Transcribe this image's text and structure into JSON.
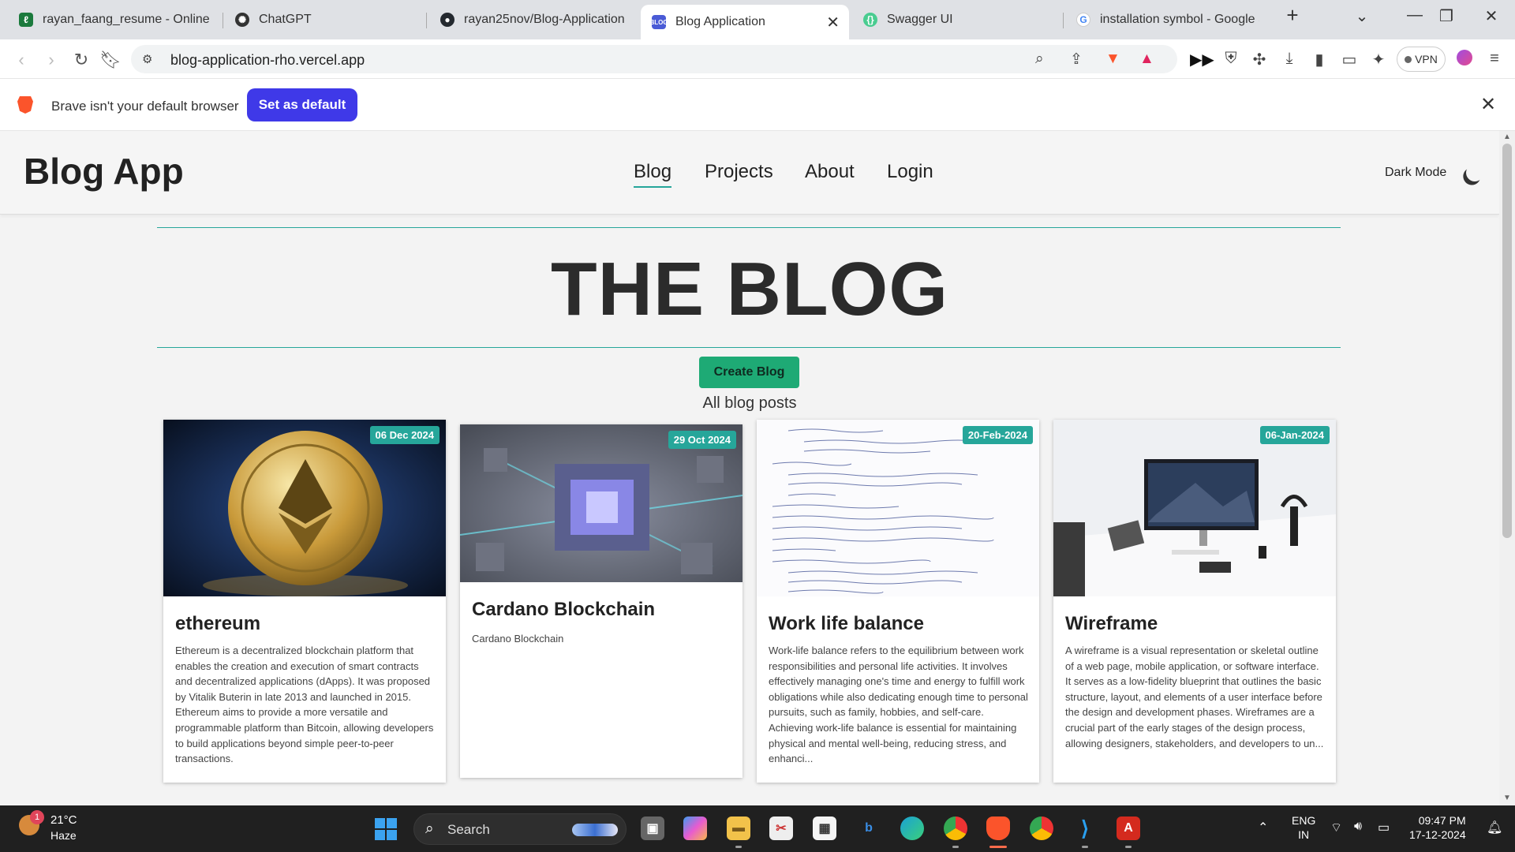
{
  "browser": {
    "tabs": [
      {
        "label": "rayan_faang_resume - Online La",
        "icon": "overleaf-icon",
        "color": "#1b7a3d"
      },
      {
        "label": "ChatGPT",
        "icon": "chatgpt-icon",
        "color": "#333333"
      },
      {
        "label": "rayan25nov/Blog-Application",
        "icon": "github-icon",
        "color": "#24292f"
      },
      {
        "label": "Blog Application",
        "icon": "blog-favicon-icon",
        "color": "#4a5bd6",
        "active": true
      },
      {
        "label": "Swagger UI",
        "icon": "swagger-icon",
        "color": "#49cc90"
      },
      {
        "label": "installation symbol - Google Se",
        "icon": "google-icon",
        "color": "#4285f4"
      }
    ],
    "url": "blog-application-rho.vercel.app",
    "vpn_label": "VPN",
    "infobar": {
      "message": "Brave isn't your default browser",
      "button": "Set as default"
    }
  },
  "site": {
    "logo": "Blog App",
    "nav": [
      "Blog",
      "Projects",
      "About",
      "Login"
    ],
    "active_nav": "Blog",
    "dark_mode_label": "Dark Mode",
    "title": "THE BLOG",
    "create_button": "Create Blog",
    "subheading": "All blog posts",
    "accent_color": "#26a69a"
  },
  "posts": [
    {
      "date": "06 Dec 2024",
      "title": "ethereum",
      "description": "Ethereum is a decentralized blockchain platform that enables the creation and execution of smart contracts and decentralized applications (dApps). It was proposed by Vitalik Buterin in late 2013 and launched in 2015. Ethereum aims to provide a more versatile and programmable platform than Bitcoin, allowing developers to build applications beyond simple peer-to-peer transactions.",
      "image": "ethereum-coin-image"
    },
    {
      "date": "29 Oct 2024",
      "title": "Cardano Blockchain",
      "description": "Cardano Blockchain",
      "image": "blockchain-cubes-image"
    },
    {
      "date": "20-Feb-2024",
      "title": "Work life balance",
      "description": "Work-life balance refers to the equilibrium between work responsibilities and personal life activities. It involves effectively managing one's time and energy to fulfill work obligations while also dedicating enough time to personal pursuits, such as family, hobbies, and self-care. Achieving work-life balance is essential for maintaining physical and mental well-being, reducing stress, and enhanci...",
      "image": "handwritten-notes-image"
    },
    {
      "date": "06-Jan-2024",
      "title": "Wireframe",
      "description": "A wireframe is a visual representation or skeletal outline of a web page, mobile application, or software interface. It serves as a low-fidelity blueprint that outlines the basic structure, layout, and elements of a user interface before the design and development phases. Wireframes are a crucial part of the early stages of the design process, allowing designers, stakeholders, and developers to un...",
      "image": "desk-setup-image"
    }
  ],
  "taskbar": {
    "weather_temp": "21°C",
    "weather_cond": "Haze",
    "weather_badge": "1",
    "search_label": "Search",
    "lang_top": "ENG",
    "lang_bottom": "IN",
    "time": "09:47 PM",
    "date": "17-12-2024"
  }
}
